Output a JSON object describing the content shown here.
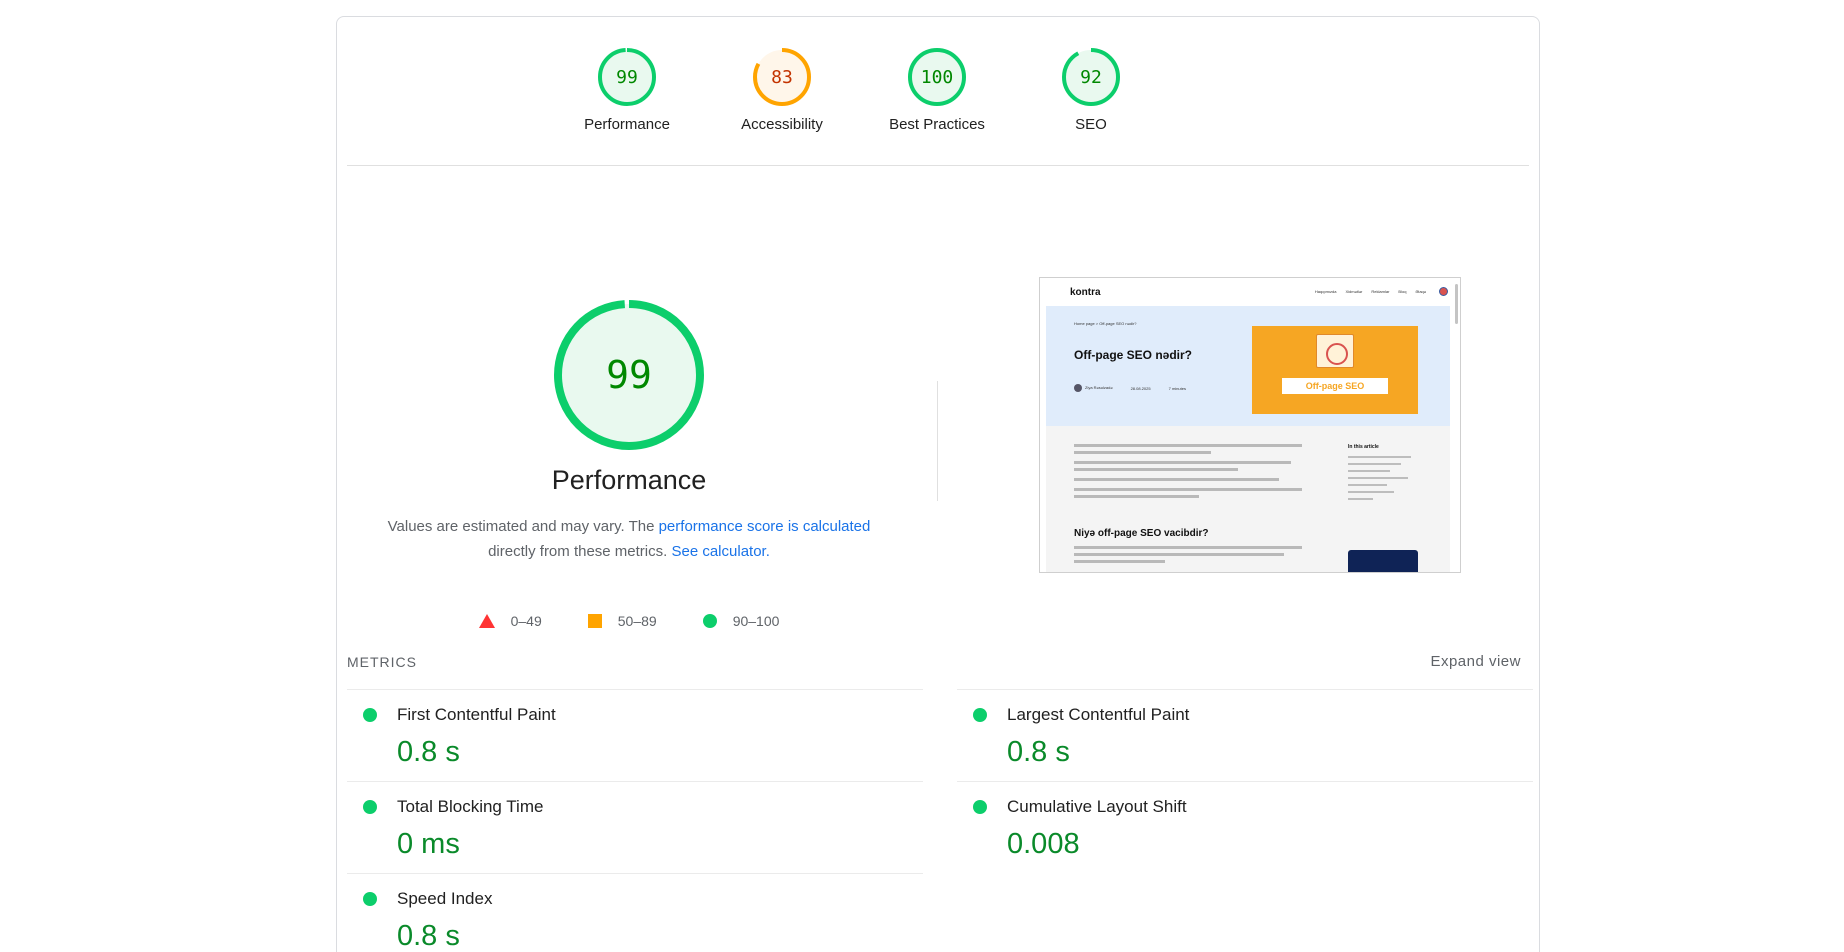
{
  "categories": [
    {
      "label": "Performance",
      "score": 99,
      "color": "#0cce6b",
      "text_color": "#008800",
      "bg": "#e9f9ef"
    },
    {
      "label": "Accessibility",
      "score": 83,
      "color": "#ffa400",
      "text_color": "#c33300",
      "bg": "#fff6ea"
    },
    {
      "label": "Best Practices",
      "score": 100,
      "color": "#0cce6b",
      "text_color": "#008800",
      "bg": "#e9f9ef"
    },
    {
      "label": "SEO",
      "score": 92,
      "color": "#0cce6b",
      "text_color": "#008800",
      "bg": "#e9f9ef"
    }
  ],
  "performance": {
    "score": 99,
    "title": "Performance",
    "desc_prefix": "Values are estimated and may vary. The ",
    "desc_link": "performance score is calculated",
    "desc_mid": " directly from these metrics. ",
    "calc_link": "See calculator."
  },
  "legend": [
    {
      "shape": "triangle",
      "label": "0–49",
      "color": "#ff3333"
    },
    {
      "shape": "square",
      "label": "50–89",
      "color": "#ffa400"
    },
    {
      "shape": "circle",
      "label": "90–100",
      "color": "#0cce6b"
    }
  ],
  "thumbnail": {
    "logo": "kontra",
    "nav": [
      "Haqqımızda",
      "Xidmətlər",
      "Reklamlar",
      "Bloq",
      "Əlaqə"
    ],
    "crumb": "Home page  >  Off-page SEO nədir?",
    "title": "Off-page SEO nədir?",
    "author": "Ziya Rəsulzadə",
    "date": "28.08.2025",
    "read_time": "7 minutes",
    "banner_label": "Off-page SEO",
    "h2": "Niyə off-page SEO vacibdir?",
    "side_title": "In this article"
  },
  "metrics": {
    "title": "METRICS",
    "expand_label": "Expand view",
    "items": [
      {
        "name": "First Contentful Paint",
        "value": "0.8 s"
      },
      {
        "name": "Largest Contentful Paint",
        "value": "0.8 s"
      },
      {
        "name": "Total Blocking Time",
        "value": "0 ms"
      },
      {
        "name": "Cumulative Layout Shift",
        "value": "0.008"
      },
      {
        "name": "Speed Index",
        "value": "0.8 s"
      }
    ]
  }
}
